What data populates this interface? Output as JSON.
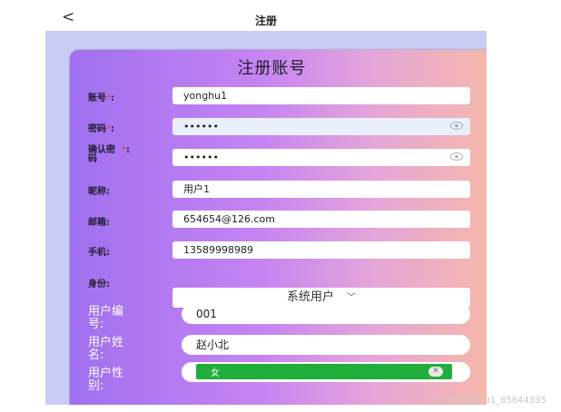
{
  "nav": {
    "back_icon": "chevron-left-icon",
    "title": "注册"
  },
  "card": {
    "title": "注册账号"
  },
  "form": {
    "account": {
      "label": "账号",
      "required": "*",
      "colon": ":",
      "value": "yonghu1"
    },
    "password": {
      "label": "密码",
      "required": "*",
      "colon": ":",
      "value": "••••••",
      "eye_icon": "eye-icon"
    },
    "confirm": {
      "label_1": "确认密",
      "label_2": "码",
      "required": "*",
      "colon": ":",
      "value": "••••••",
      "eye_icon": "eye-icon"
    },
    "nickname": {
      "label": "昵称:",
      "value": "用户1"
    },
    "email": {
      "label": "邮箱:",
      "value": "654654@126.com"
    },
    "phone": {
      "label": "手机:",
      "value": "13589998989"
    },
    "role": {
      "label": "身份:",
      "value": "系统用户",
      "chevron": "﹀"
    },
    "user_no": {
      "label_1": "用户编",
      "label_2": "号:",
      "value": "001"
    },
    "user_name": {
      "label_1": "用户姓",
      "label_2": "名:",
      "value": "赵小北"
    },
    "user_gender": {
      "label_1": "用户性",
      "label_2": "别:",
      "value": "女",
      "clear": "✕"
    }
  },
  "watermark": "CSDN @2401_85644395"
}
